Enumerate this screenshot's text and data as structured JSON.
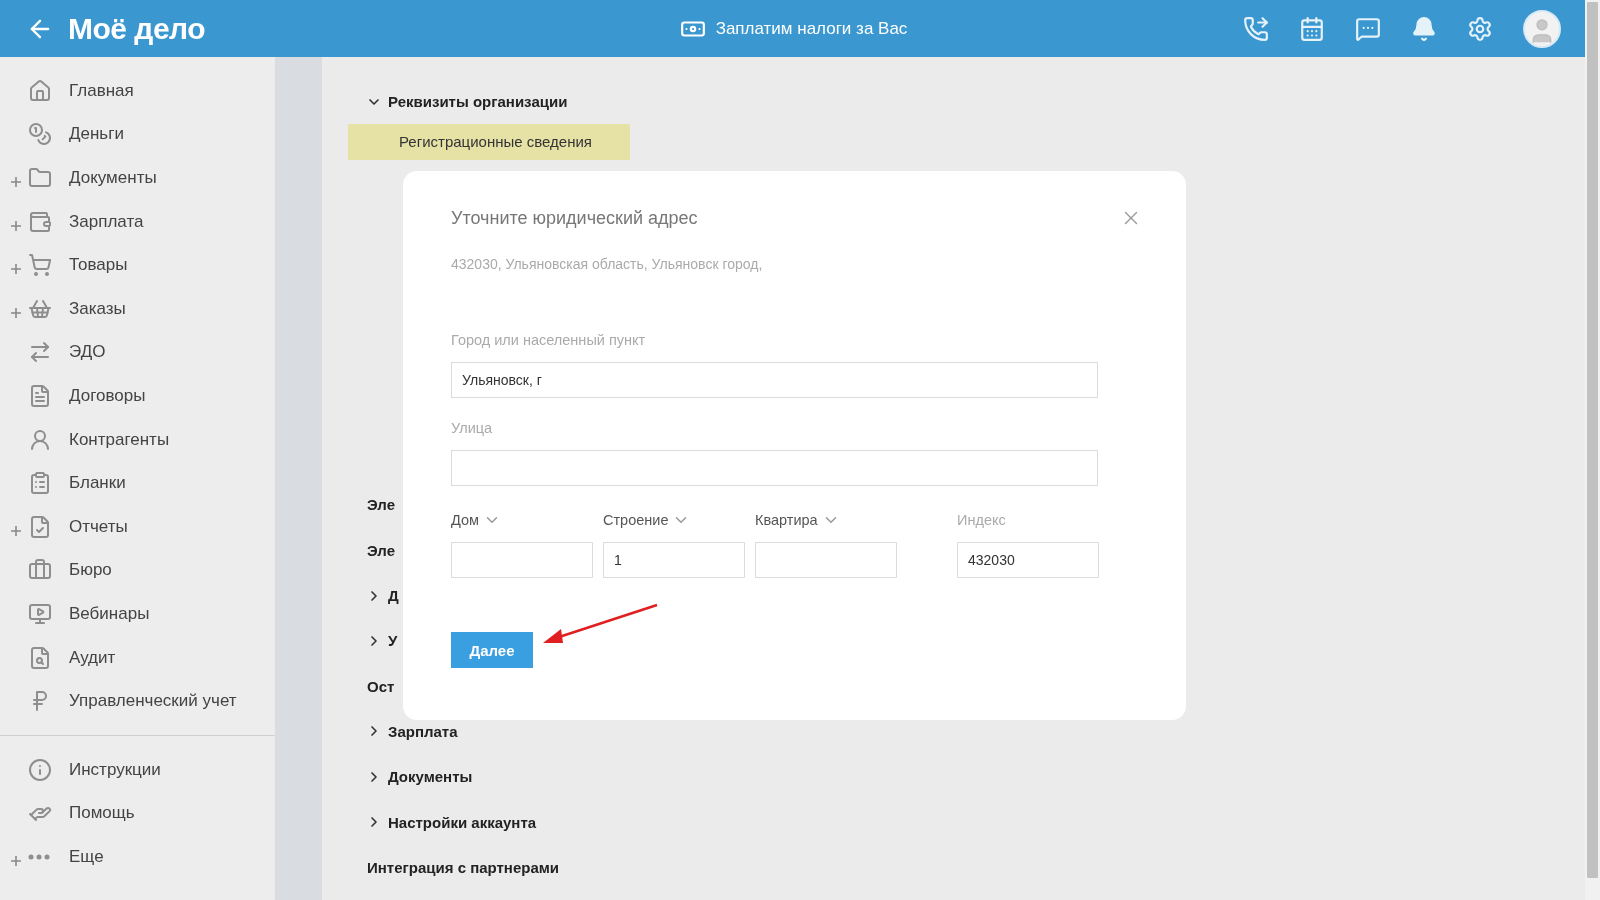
{
  "header": {
    "logo": "Моё дело",
    "promo": "Заплатим налоги за Вас"
  },
  "sidebar": {
    "items": [
      {
        "label": "Главная",
        "expandable": false
      },
      {
        "label": "Деньги",
        "expandable": false
      },
      {
        "label": "Документы",
        "expandable": true
      },
      {
        "label": "Зарплата",
        "expandable": true
      },
      {
        "label": "Товары",
        "expandable": true
      },
      {
        "label": "Заказы",
        "expandable": true
      },
      {
        "label": "ЭДО",
        "expandable": false
      },
      {
        "label": "Договоры",
        "expandable": false
      },
      {
        "label": "Контрагенты",
        "expandable": false
      },
      {
        "label": "Бланки",
        "expandable": false
      },
      {
        "label": "Отчеты",
        "expandable": true
      },
      {
        "label": "Бюро",
        "expandable": false
      },
      {
        "label": "Вебинары",
        "expandable": false
      },
      {
        "label": "Аудит",
        "expandable": false
      },
      {
        "label": "Управленческий учет",
        "expandable": false
      }
    ],
    "bottom_items": [
      {
        "label": "Инструкции",
        "expandable": false
      },
      {
        "label": "Помощь",
        "expandable": false
      },
      {
        "label": "Еще",
        "expandable": true
      }
    ]
  },
  "settings": {
    "sections": [
      {
        "label": "Реквизиты организации",
        "kind": "group",
        "expanded": true,
        "children": [
          {
            "label": "Регистрационные сведения",
            "selected": true
          }
        ]
      },
      {
        "label": "Эле",
        "kind": "heading"
      },
      {
        "label": "Эле",
        "kind": "heading"
      },
      {
        "label": "Д",
        "kind": "group",
        "expanded": false
      },
      {
        "label": "У",
        "kind": "group",
        "expanded": false
      },
      {
        "label": "Ост",
        "kind": "heading"
      },
      {
        "label": "Зарплата",
        "kind": "group",
        "expanded": false
      },
      {
        "label": "Документы",
        "kind": "group",
        "expanded": false
      },
      {
        "label": "Настройки аккаунта",
        "kind": "group",
        "expanded": false
      },
      {
        "label": "Интеграция с партнерами",
        "kind": "heading"
      }
    ]
  },
  "dialog": {
    "title": "Уточните юридический адрес",
    "address": "432030, Ульяновская область, Ульяновск город,",
    "fields": [
      {
        "label": "Город или населенный пункт",
        "value": "Ульяновск, г"
      },
      {
        "label": "Улица"
      }
    ],
    "parts": [
      {
        "label": "Дом",
        "kind": "dropdown"
      },
      {
        "label": "Строение",
        "kind": "dropdown",
        "value": "1"
      },
      {
        "label": "Квартира",
        "kind": "dropdown"
      },
      {
        "label": "Индекс",
        "kind": "plain",
        "value": "432030"
      }
    ],
    "button": "Далее"
  }
}
